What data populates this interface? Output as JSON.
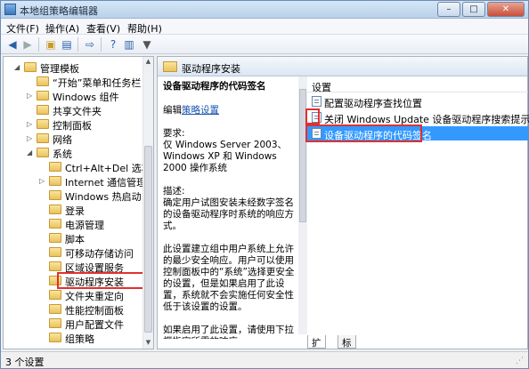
{
  "window": {
    "title": "本地组策略编辑器",
    "controls": {
      "minimize": "–",
      "maximize": "□",
      "close": "✕"
    }
  },
  "menu": [
    "文件(F)",
    "操作(A)",
    "查看(V)",
    "帮助(H)"
  ],
  "toolbar": [
    "back-icon",
    "forward-icon",
    "up-folder-icon",
    "show-tree-icon",
    "export-icon",
    "help-icon",
    "properties-icon",
    "filter-icon"
  ],
  "tree": {
    "items": [
      {
        "label": "管理模板",
        "expanded": true
      },
      {
        "label": "“开始”菜单和任务栏",
        "expanded": false
      },
      {
        "label": "Windows 组件",
        "expanded": false
      },
      {
        "label": "共享文件夹",
        "expanded": false
      },
      {
        "label": "控制面板",
        "expanded": false
      },
      {
        "label": "网络",
        "expanded": false
      },
      {
        "label": "系统",
        "expanded": true
      },
      {
        "label": "Ctrl+Alt+Del 选项"
      },
      {
        "label": "Internet 通信管理"
      },
      {
        "label": "Windows 热启动"
      },
      {
        "label": "登录"
      },
      {
        "label": "电源管理"
      },
      {
        "label": "脚本"
      },
      {
        "label": "可移动存储访问"
      },
      {
        "label": "区域设置服务"
      },
      {
        "label": "驱动程序安装",
        "highlighted": true
      },
      {
        "label": "文件夹重定向"
      },
      {
        "label": "性能控制面板"
      },
      {
        "label": "用户配置文件"
      },
      {
        "label": "组策略"
      }
    ]
  },
  "right_header": {
    "label": "驱动程序安装"
  },
  "description": {
    "title": "设备驱动程序的代码签名",
    "edit_prefix": "编辑",
    "edit_link": "策略设置",
    "requirements_label": "要求:",
    "requirements_text": "仅 Windows Server 2003、Windows XP 和 Windows 2000 操作系统",
    "description_label": "描述:",
    "description_text": "确定用户试图安装未经数字签名的设备驱动程序时系统的响应方式。",
    "para1": "此设置建立组中用户系统上允许的最少安全响应。用户可以使用控制面板中的“系统”选择更安全的设置，但是如果启用了此设置，系统就不会实施任何安全性低于该设置的设置。",
    "para2": "如果启用了此设置，请使用下拉框指定所需的响应。"
  },
  "list": {
    "column": "设置",
    "rows": [
      {
        "label": "配置驱动程序查找位置",
        "selected": false
      },
      {
        "label": "关闭 Windows Update 设备驱动程序搜索提示",
        "selected": false
      },
      {
        "label": "设备驱动程序的代码签名",
        "selected": true
      }
    ]
  },
  "tabs": [
    "扩展",
    "标准"
  ],
  "status": {
    "text": "3 个设置"
  }
}
